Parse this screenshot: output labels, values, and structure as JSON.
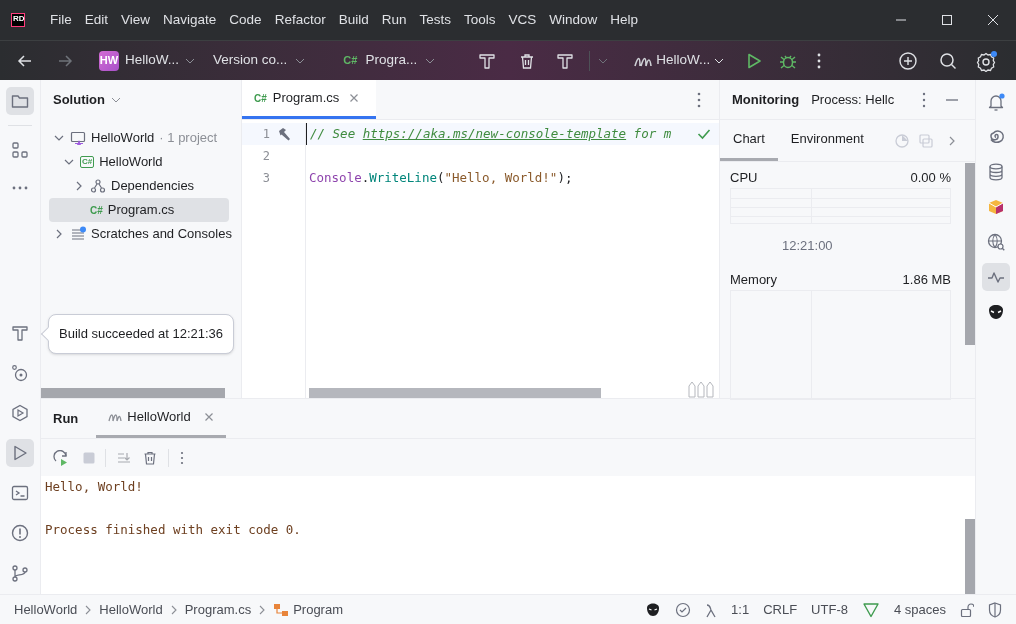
{
  "logo": {
    "text": "RD"
  },
  "menu": [
    "File",
    "Edit",
    "View",
    "Navigate",
    "Code",
    "Refactor",
    "Build",
    "Run",
    "Tests",
    "Tools",
    "VCS",
    "Window",
    "Help"
  ],
  "toolbar": {
    "project": {
      "badge": "HW",
      "label": "HelloW..."
    },
    "vcs": "Version co...",
    "file": {
      "lang": "C#",
      "label": "Progra..."
    },
    "run_config": "HelloW..."
  },
  "solution": {
    "title": "Solution",
    "tree": [
      {
        "label": "HelloWorld",
        "note": "· 1 project",
        "kind": "solution",
        "expanded": true,
        "selected": false,
        "children": [
          {
            "label": "HelloWorld",
            "kind": "project",
            "lang": "C#",
            "expanded": true,
            "selected": false,
            "children": [
              {
                "label": "Dependencies",
                "kind": "dependencies",
                "expanded": false,
                "selected": false
              },
              {
                "label": "Program.cs",
                "kind": "file",
                "lang": "C#",
                "selected": true
              }
            ]
          }
        ]
      },
      {
        "label": "Scratches and Consoles",
        "kind": "scratches",
        "expanded": false,
        "selected": false
      }
    ]
  },
  "tooltip": "Build succeeded at 12:21:36",
  "editor": {
    "tabs": [
      {
        "lang": "C#",
        "label": "Program.cs",
        "selected": true
      }
    ],
    "lines": [
      {
        "number": "1",
        "current": true,
        "tokens": [
          {
            "kind": "comment",
            "text": "// See "
          },
          {
            "kind": "link",
            "text": "https://aka.ms/new-console-template"
          },
          {
            "kind": "comment",
            "text": " for m"
          }
        ]
      },
      {
        "number": "2",
        "current": false
      },
      {
        "number": "3",
        "current": false,
        "tokens": [
          {
            "kind": "class",
            "text": "Console"
          },
          {
            "kind": "plain",
            "text": "."
          },
          {
            "kind": "method",
            "text": "WriteLine"
          },
          {
            "kind": "plain",
            "text": "("
          },
          {
            "kind": "string",
            "text": "\"Hello, World!\""
          },
          {
            "kind": "plain",
            "text": ");"
          }
        ]
      }
    ]
  },
  "monitoring": {
    "title": "Monitoring",
    "process": "Process: Hellc",
    "tabs": [
      {
        "label": "Chart",
        "selected": true
      },
      {
        "label": "Environment",
        "selected": false
      }
    ],
    "cpu": {
      "label": "CPU",
      "value": "0.00 %",
      "time": "12:21:00"
    },
    "memory": {
      "label": "Memory",
      "value": "1.86 MB"
    }
  },
  "run_panel": {
    "title": "Run",
    "tabs": [
      {
        "label": "HelloWorld",
        "selected": true
      }
    ],
    "output": [
      {
        "text": "Hello, World!",
        "blank_line_before": false
      },
      {
        "text": "Process finished with exit code 0.",
        "blank_line_before": true
      }
    ]
  },
  "status_bar": {
    "breadcrumbs": [
      {
        "label": "HelloWorld",
        "kind": "plain"
      },
      {
        "label": "HelloWorld",
        "kind": "plain"
      },
      {
        "label": "Program.cs",
        "kind": "plain"
      },
      {
        "label": "Program",
        "kind": "class"
      }
    ],
    "position": "1:1",
    "line_ending": "CRLF",
    "encoding": "UTF-8",
    "indent": "4 spaces"
  }
}
